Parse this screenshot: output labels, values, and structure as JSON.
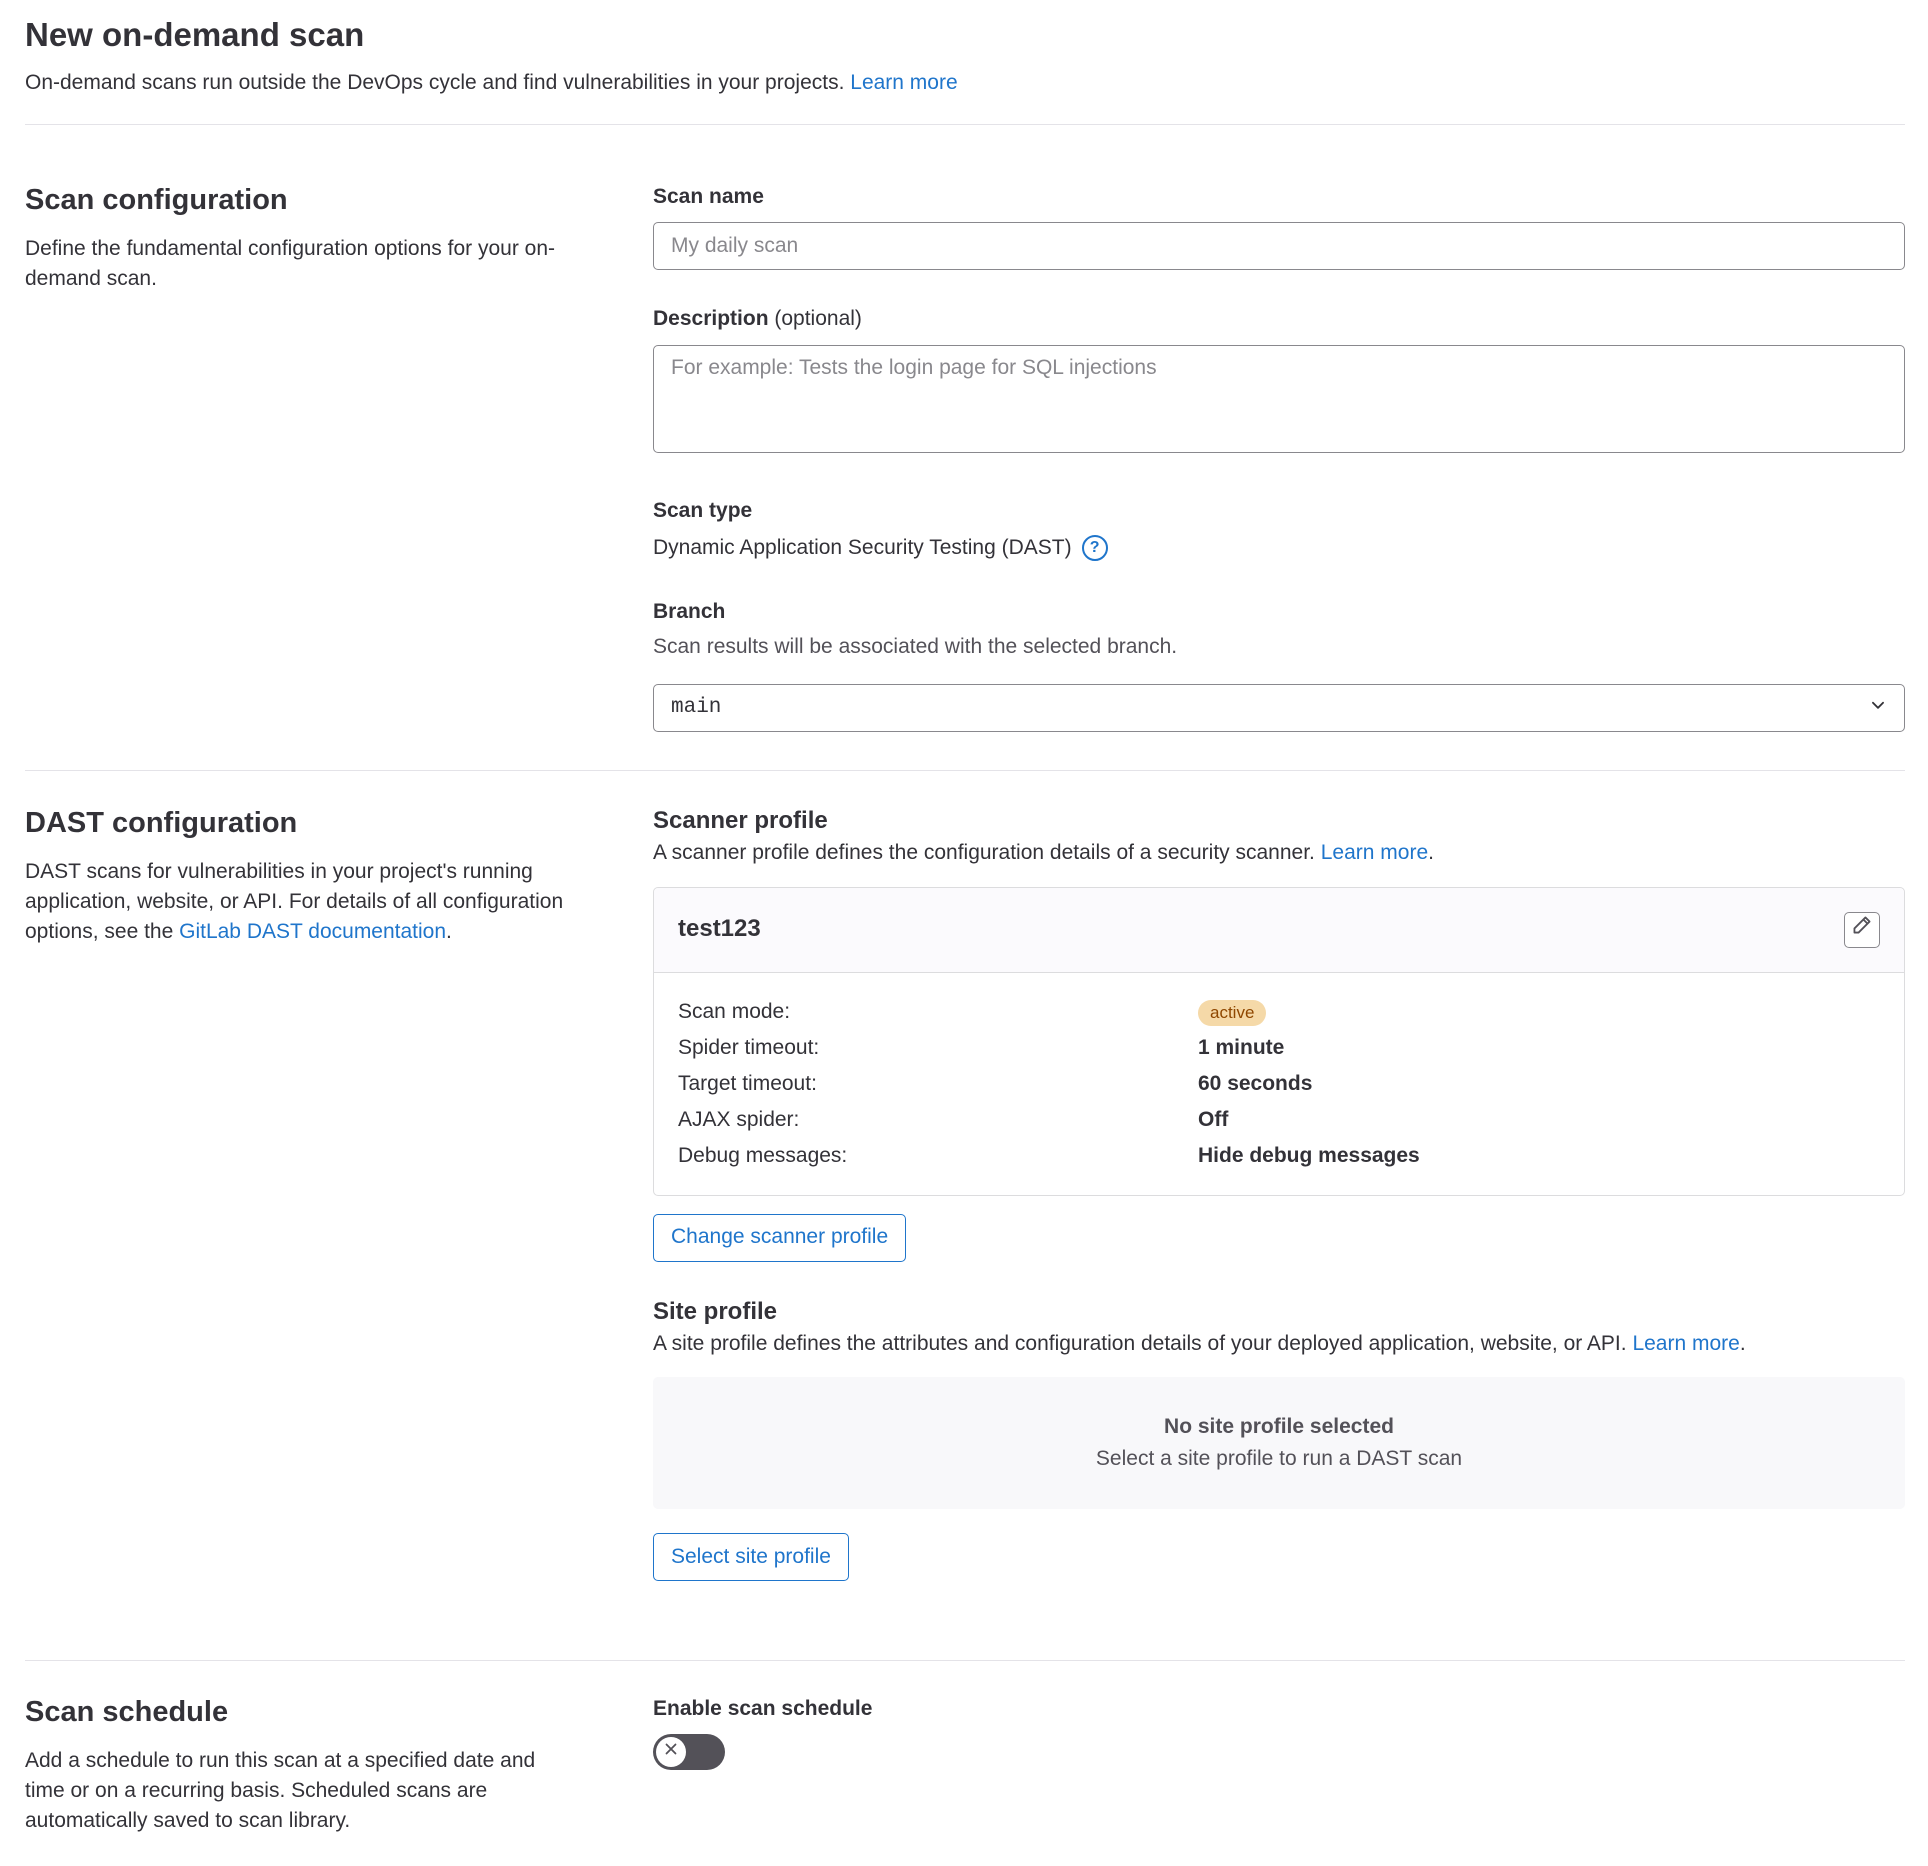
{
  "header": {
    "title": "New on-demand scan",
    "description": "On-demand scans run outside the DevOps cycle and find vulnerabilities in your projects.",
    "learn_more": "Learn more"
  },
  "scan_configuration": {
    "title": "Scan configuration",
    "description": "Define the fundamental configuration options for your on-demand scan.",
    "scan_name_label": "Scan name",
    "scan_name_placeholder": "My daily scan",
    "scan_name_value": "",
    "description_label": "Description",
    "description_optional": "(optional)",
    "description_placeholder": "For example: Tests the login page for SQL injections",
    "scan_type_label": "Scan type",
    "scan_type_value": "Dynamic Application Security Testing (DAST)",
    "branch_label": "Branch",
    "branch_help": "Scan results will be associated with the selected branch.",
    "branch_value": "main"
  },
  "dast_configuration": {
    "title": "DAST configuration",
    "description_pre": "DAST scans for vulnerabilities in your project's running application, website, or API. For details of all configuration options, see the ",
    "description_link": "GitLab DAST documentation",
    "description_post": ".",
    "scanner_profile": {
      "title": "Scanner profile",
      "description": "A scanner profile defines the configuration details of a security scanner.",
      "learn_more": "Learn more",
      "period": ".",
      "profile_name": "test123",
      "rows": [
        {
          "label": "Scan mode:",
          "value": "active"
        },
        {
          "label": "Spider timeout:",
          "value": "1 minute"
        },
        {
          "label": "Target timeout:",
          "value": "60 seconds"
        },
        {
          "label": "AJAX spider:",
          "value": "Off"
        },
        {
          "label": "Debug messages:",
          "value": "Hide debug messages"
        }
      ],
      "change_button": "Change scanner profile"
    },
    "site_profile": {
      "title": "Site profile",
      "description": "A site profile defines the attributes and configuration details of your deployed application, website, or API.",
      "learn_more": "Learn more",
      "period": ".",
      "empty_title": "No site profile selected",
      "empty_subtitle": "Select a site profile to run a DAST scan",
      "select_button": "Select site profile"
    }
  },
  "scan_schedule": {
    "title": "Scan schedule",
    "description": "Add a schedule to run this scan at a specified date and time or on a recurring basis. Scheduled scans are automatically saved to scan library.",
    "toggle_label": "Enable scan schedule",
    "enabled": false
  },
  "icons": {
    "help": "question-circle-icon",
    "chevron": "chevron-down-icon",
    "edit": "pencil-icon",
    "toggle_off": "close-icon"
  },
  "colors": {
    "link": "#1f75cb",
    "badge_bg": "#f5d9a8",
    "badge_text": "#8f4700",
    "toggle_off": "#535158"
  }
}
